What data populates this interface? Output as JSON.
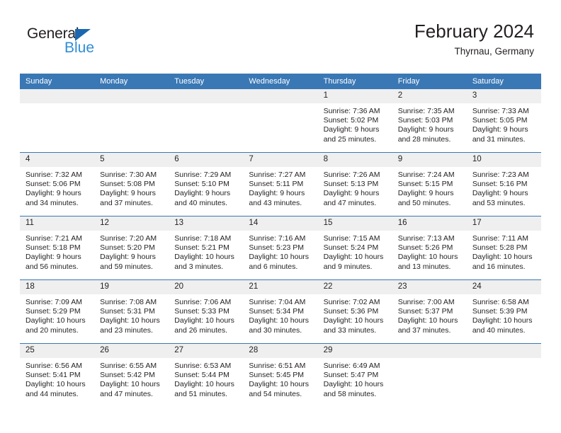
{
  "brand": {
    "name_top": "General",
    "name_bottom": "Blue",
    "triangle_color": "#1b68b0",
    "blue_color": "#2f8ed6"
  },
  "header": {
    "title": "February 2024",
    "location": "Thyrnau, Germany"
  },
  "theme": {
    "header_blue": "#3a78b5",
    "daynum_bg": "#efefef",
    "text": "#231f20"
  },
  "weekdays": [
    "Sunday",
    "Monday",
    "Tuesday",
    "Wednesday",
    "Thursday",
    "Friday",
    "Saturday"
  ],
  "weeks": [
    [
      {
        "day": "",
        "lines": []
      },
      {
        "day": "",
        "lines": []
      },
      {
        "day": "",
        "lines": []
      },
      {
        "day": "",
        "lines": []
      },
      {
        "day": "1",
        "lines": [
          "Sunrise: 7:36 AM",
          "Sunset: 5:02 PM",
          "Daylight: 9 hours",
          "and 25 minutes."
        ]
      },
      {
        "day": "2",
        "lines": [
          "Sunrise: 7:35 AM",
          "Sunset: 5:03 PM",
          "Daylight: 9 hours",
          "and 28 minutes."
        ]
      },
      {
        "day": "3",
        "lines": [
          "Sunrise: 7:33 AM",
          "Sunset: 5:05 PM",
          "Daylight: 9 hours",
          "and 31 minutes."
        ]
      }
    ],
    [
      {
        "day": "4",
        "lines": [
          "Sunrise: 7:32 AM",
          "Sunset: 5:06 PM",
          "Daylight: 9 hours",
          "and 34 minutes."
        ]
      },
      {
        "day": "5",
        "lines": [
          "Sunrise: 7:30 AM",
          "Sunset: 5:08 PM",
          "Daylight: 9 hours",
          "and 37 minutes."
        ]
      },
      {
        "day": "6",
        "lines": [
          "Sunrise: 7:29 AM",
          "Sunset: 5:10 PM",
          "Daylight: 9 hours",
          "and 40 minutes."
        ]
      },
      {
        "day": "7",
        "lines": [
          "Sunrise: 7:27 AM",
          "Sunset: 5:11 PM",
          "Daylight: 9 hours",
          "and 43 minutes."
        ]
      },
      {
        "day": "8",
        "lines": [
          "Sunrise: 7:26 AM",
          "Sunset: 5:13 PM",
          "Daylight: 9 hours",
          "and 47 minutes."
        ]
      },
      {
        "day": "9",
        "lines": [
          "Sunrise: 7:24 AM",
          "Sunset: 5:15 PM",
          "Daylight: 9 hours",
          "and 50 minutes."
        ]
      },
      {
        "day": "10",
        "lines": [
          "Sunrise: 7:23 AM",
          "Sunset: 5:16 PM",
          "Daylight: 9 hours",
          "and 53 minutes."
        ]
      }
    ],
    [
      {
        "day": "11",
        "lines": [
          "Sunrise: 7:21 AM",
          "Sunset: 5:18 PM",
          "Daylight: 9 hours",
          "and 56 minutes."
        ]
      },
      {
        "day": "12",
        "lines": [
          "Sunrise: 7:20 AM",
          "Sunset: 5:20 PM",
          "Daylight: 9 hours",
          "and 59 minutes."
        ]
      },
      {
        "day": "13",
        "lines": [
          "Sunrise: 7:18 AM",
          "Sunset: 5:21 PM",
          "Daylight: 10 hours",
          "and 3 minutes."
        ]
      },
      {
        "day": "14",
        "lines": [
          "Sunrise: 7:16 AM",
          "Sunset: 5:23 PM",
          "Daylight: 10 hours",
          "and 6 minutes."
        ]
      },
      {
        "day": "15",
        "lines": [
          "Sunrise: 7:15 AM",
          "Sunset: 5:24 PM",
          "Daylight: 10 hours",
          "and 9 minutes."
        ]
      },
      {
        "day": "16",
        "lines": [
          "Sunrise: 7:13 AM",
          "Sunset: 5:26 PM",
          "Daylight: 10 hours",
          "and 13 minutes."
        ]
      },
      {
        "day": "17",
        "lines": [
          "Sunrise: 7:11 AM",
          "Sunset: 5:28 PM",
          "Daylight: 10 hours",
          "and 16 minutes."
        ]
      }
    ],
    [
      {
        "day": "18",
        "lines": [
          "Sunrise: 7:09 AM",
          "Sunset: 5:29 PM",
          "Daylight: 10 hours",
          "and 20 minutes."
        ]
      },
      {
        "day": "19",
        "lines": [
          "Sunrise: 7:08 AM",
          "Sunset: 5:31 PM",
          "Daylight: 10 hours",
          "and 23 minutes."
        ]
      },
      {
        "day": "20",
        "lines": [
          "Sunrise: 7:06 AM",
          "Sunset: 5:33 PM",
          "Daylight: 10 hours",
          "and 26 minutes."
        ]
      },
      {
        "day": "21",
        "lines": [
          "Sunrise: 7:04 AM",
          "Sunset: 5:34 PM",
          "Daylight: 10 hours",
          "and 30 minutes."
        ]
      },
      {
        "day": "22",
        "lines": [
          "Sunrise: 7:02 AM",
          "Sunset: 5:36 PM",
          "Daylight: 10 hours",
          "and 33 minutes."
        ]
      },
      {
        "day": "23",
        "lines": [
          "Sunrise: 7:00 AM",
          "Sunset: 5:37 PM",
          "Daylight: 10 hours",
          "and 37 minutes."
        ]
      },
      {
        "day": "24",
        "lines": [
          "Sunrise: 6:58 AM",
          "Sunset: 5:39 PM",
          "Daylight: 10 hours",
          "and 40 minutes."
        ]
      }
    ],
    [
      {
        "day": "25",
        "lines": [
          "Sunrise: 6:56 AM",
          "Sunset: 5:41 PM",
          "Daylight: 10 hours",
          "and 44 minutes."
        ]
      },
      {
        "day": "26",
        "lines": [
          "Sunrise: 6:55 AM",
          "Sunset: 5:42 PM",
          "Daylight: 10 hours",
          "and 47 minutes."
        ]
      },
      {
        "day": "27",
        "lines": [
          "Sunrise: 6:53 AM",
          "Sunset: 5:44 PM",
          "Daylight: 10 hours",
          "and 51 minutes."
        ]
      },
      {
        "day": "28",
        "lines": [
          "Sunrise: 6:51 AM",
          "Sunset: 5:45 PM",
          "Daylight: 10 hours",
          "and 54 minutes."
        ]
      },
      {
        "day": "29",
        "lines": [
          "Sunrise: 6:49 AM",
          "Sunset: 5:47 PM",
          "Daylight: 10 hours",
          "and 58 minutes."
        ]
      },
      {
        "day": "",
        "lines": []
      },
      {
        "day": "",
        "lines": []
      }
    ]
  ]
}
